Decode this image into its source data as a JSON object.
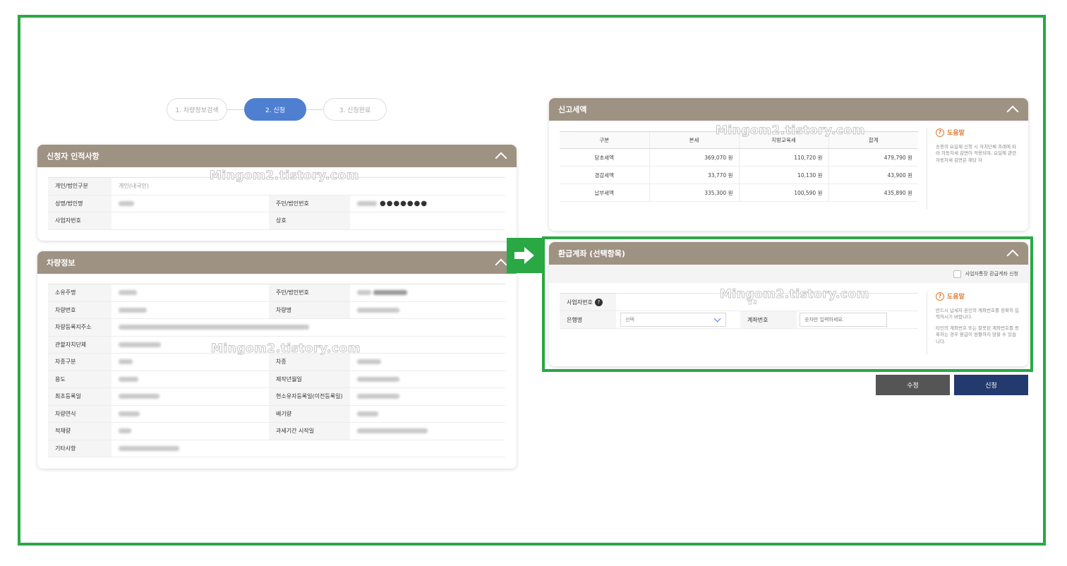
{
  "stepper": {
    "steps": [
      "1. 차량정보검색",
      "2. 신청",
      "3. 신청완료"
    ]
  },
  "applicant": {
    "title": "신청자 인적사항",
    "type_label": "개인/법인구분",
    "type_value": "개인(내국인)",
    "name_label": "성명/법인명",
    "id_label": "주민/법인번호",
    "id_mask": "●●●●●●●",
    "biz_label": "사업자번호",
    "trade_label": "상호"
  },
  "vehicle": {
    "title": "차량정보",
    "owner_label": "소유주명",
    "owner_id_label": "주민/법인번호",
    "plate_label": "차량번호",
    "car_name_label": "차량명",
    "address_label": "차량등록지주소",
    "gov_label": "관할자치단체",
    "kind_label": "차종구분",
    "type_label": "차종",
    "usage_label": "용도",
    "made_label": "제작년월일",
    "first_reg_label": "최초등록일",
    "owner_reg_label": "현소유자등록일(이전등록일)",
    "model_label": "차량연식",
    "cc_label": "배기량",
    "load_label": "적재량",
    "tax_start_label": "과세기간 시작일",
    "etc_label": "기타사항"
  },
  "tax": {
    "title": "신고세액",
    "headers": [
      "구분",
      "본세",
      "지방교육세",
      "합계"
    ],
    "rows": [
      {
        "label": "당초세액",
        "base": "369,070 원",
        "edu": "110,720 원",
        "total": "479,790 원"
      },
      {
        "label": "경감세액",
        "base": "33,770 원",
        "edu": "10,130 원",
        "total": "43,900 원"
      },
      {
        "label": "납부세액",
        "base": "335,300 원",
        "edu": "100,590 원",
        "total": "435,890 원"
      }
    ],
    "help_title": "도움말",
    "help_text": "승용의 요일제 신청 시 자치단체 조례에 따라 자동차세 감면이 적용되며, 요일제 관련 자동차세 감면은 해당 자"
  },
  "refund": {
    "title": "환급계좌 (선택항목)",
    "checkbox_label": "사업자통장 환급계좌 신청",
    "biz_label": "사업자번호",
    "owner_label": "상호",
    "bank_label": "은행명",
    "bank_select": "선택",
    "account_label": "계좌번호",
    "account_placeholder": "숫자만 입력하세요.",
    "help_title": "도움말",
    "help_1": "반드시 납세자 본인의 계좌번호를 정확히 입력하시기 바랍니다.",
    "help_2": "타인의 계좌번호 또는 잘못된 계좌번호를 등록하는 경우 환급이 원활하지 않을 수 있습니다."
  },
  "buttons": {
    "edit": "수정",
    "apply": "신청"
  },
  "watermark": "Mingom2.tistory.com",
  "colors": {
    "accent_blue": "#4f7fd0",
    "panel_header": "#9e9283",
    "highlight_green": "#2aa844",
    "apply_navy": "#233a6e",
    "help_orange": "#e07a2e"
  }
}
